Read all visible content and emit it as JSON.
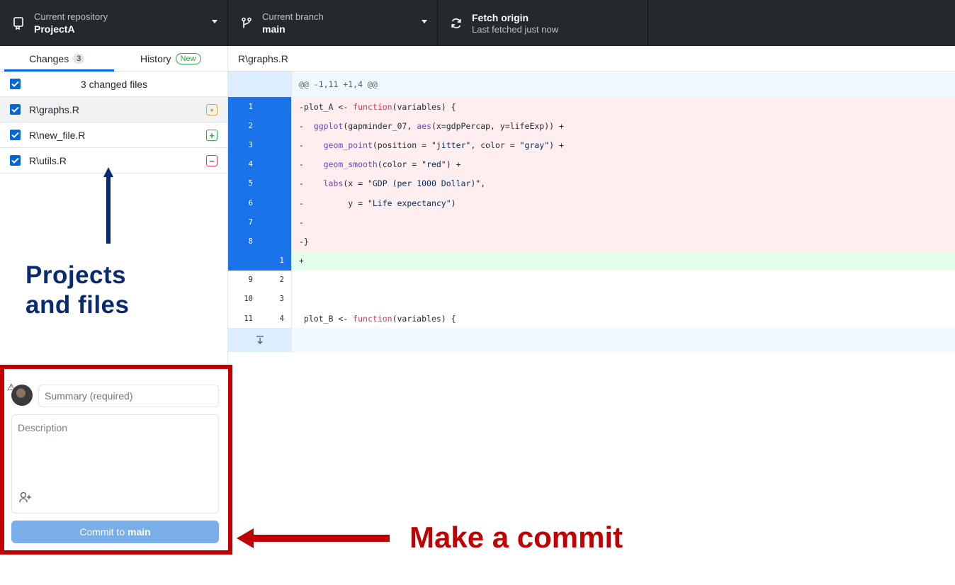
{
  "toolbar": {
    "repo_label": "Current repository",
    "repo_value": "ProjectA",
    "branch_label": "Current branch",
    "branch_value": "main",
    "fetch_label": "Fetch origin",
    "fetch_status": "Last fetched just now"
  },
  "sidebar": {
    "tabs": [
      {
        "label": "Changes",
        "badge": "3"
      },
      {
        "label": "History",
        "badge": "New"
      }
    ],
    "changed_files_label": "3 changed files",
    "files": [
      {
        "name": "R\\graphs.R",
        "status": "modified",
        "status_glyph": "•",
        "color": "#d4a72c"
      },
      {
        "name": "R\\new_file.R",
        "status": "added",
        "status_glyph": "+",
        "color": "#28a745"
      },
      {
        "name": "R\\utils.R",
        "status": "deleted",
        "status_glyph": "−",
        "color": "#d73a49"
      }
    ]
  },
  "annotations": {
    "projects_line1": "Projects",
    "projects_line2": "and files",
    "commit": "Make a commit"
  },
  "diff": {
    "path": "R\\graphs.R",
    "hunk": "@@ -1,11 +1,4 @@",
    "lines": [
      {
        "old": "1",
        "new": "",
        "type": "del",
        "prefix": "-",
        "code": "plot_A <- function(variables) {"
      },
      {
        "old": "2",
        "new": "",
        "type": "del",
        "prefix": "-",
        "code": "  ggplot(gapminder_07, aes(x=gdpPercap, y=lifeExp)) +"
      },
      {
        "old": "3",
        "new": "",
        "type": "del",
        "prefix": "-",
        "code": "    geom_point(position = \"jitter\", color = \"gray\") +"
      },
      {
        "old": "4",
        "new": "",
        "type": "del",
        "prefix": "-",
        "code": "    geom_smooth(color = \"red\") +"
      },
      {
        "old": "5",
        "new": "",
        "type": "del",
        "prefix": "-",
        "code": "    labs(x = \"GDP (per 1000 Dollar)\","
      },
      {
        "old": "6",
        "new": "",
        "type": "del",
        "prefix": "-",
        "code": "         y = \"Life expectancy\")"
      },
      {
        "old": "7",
        "new": "",
        "type": "del",
        "prefix": "-",
        "code": ""
      },
      {
        "old": "8",
        "new": "",
        "type": "del",
        "prefix": "-",
        "code": "}"
      },
      {
        "old": "",
        "new": "1",
        "type": "add",
        "prefix": "+",
        "code": ""
      },
      {
        "old": "9",
        "new": "2",
        "type": "ctx",
        "prefix": " ",
        "code": ""
      },
      {
        "old": "10",
        "new": "3",
        "type": "ctx",
        "prefix": " ",
        "code": ""
      },
      {
        "old": "11",
        "new": "4",
        "type": "ctx",
        "prefix": " ",
        "code": "plot_B <- function(variables) {"
      }
    ]
  },
  "commit": {
    "summary_placeholder": "Summary (required)",
    "description_placeholder": "Description",
    "button_prefix": "Commit to",
    "button_branch": "main"
  },
  "icons": {
    "repo": "repo-icon",
    "branch": "branch-icon",
    "fetch": "sync-icon",
    "coauthor": "add-coauthor-icon",
    "expand": "expand-down-icon",
    "warning": "warning-icon"
  },
  "colors": {
    "toolbar_bg": "#24292e",
    "accent": "#0366d6",
    "annotation_blue": "#0a2a6e",
    "annotation_red": "#c00000",
    "deleted_bg": "#ffeef0",
    "added_bg": "#e6ffed"
  }
}
